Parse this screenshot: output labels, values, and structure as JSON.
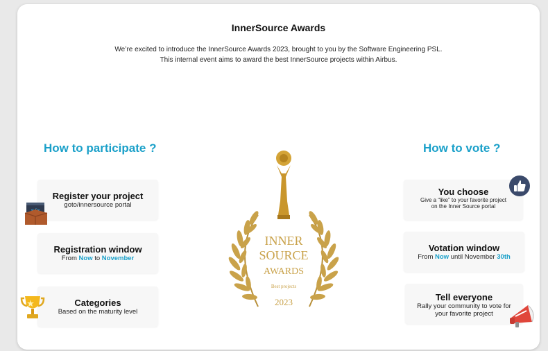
{
  "header": {
    "title": "InnerSource Awards",
    "intro_line1": "We’re excited to introduce the InnerSource Awards 2023, brought to you by the Software Engineering PSL.",
    "intro_line2": "This internal event aims to award the best InnerSource projects within Airbus."
  },
  "participate": {
    "heading": "How to participate ?",
    "register": {
      "title": "Register your project",
      "sub": "goto/innersource portal"
    },
    "window": {
      "title": "Registration window",
      "from": "From ",
      "now": "Now",
      "to": " to ",
      "month": "November"
    },
    "categories": {
      "title": "Categories",
      "sub": "Based on the maturity level"
    }
  },
  "vote": {
    "heading": "How to vote ?",
    "choose": {
      "title": "You choose",
      "sub1": "Give a “like” to your favorite project",
      "sub2": "on the Inner Source portal"
    },
    "window": {
      "title": "Votation window",
      "from": "From ",
      "now": "Now",
      "until": " until November ",
      "day": "30th"
    },
    "tell": {
      "title": "Tell everyone",
      "sub1": "Rally your community to vote for",
      "sub2": "your favorite project"
    }
  },
  "award": {
    "line1": "INNER",
    "line2": "SOURCE",
    "line3": "AWARDS",
    "line4": "Best projects",
    "year": "2023"
  },
  "colors": {
    "accent": "#1aa0c9",
    "gold": "#c9a24a"
  },
  "icons": [
    "code-box-icon",
    "trophy-icon",
    "thumbs-up-icon",
    "megaphone-icon",
    "laurel-wreath-icon",
    "statuette-icon"
  ]
}
